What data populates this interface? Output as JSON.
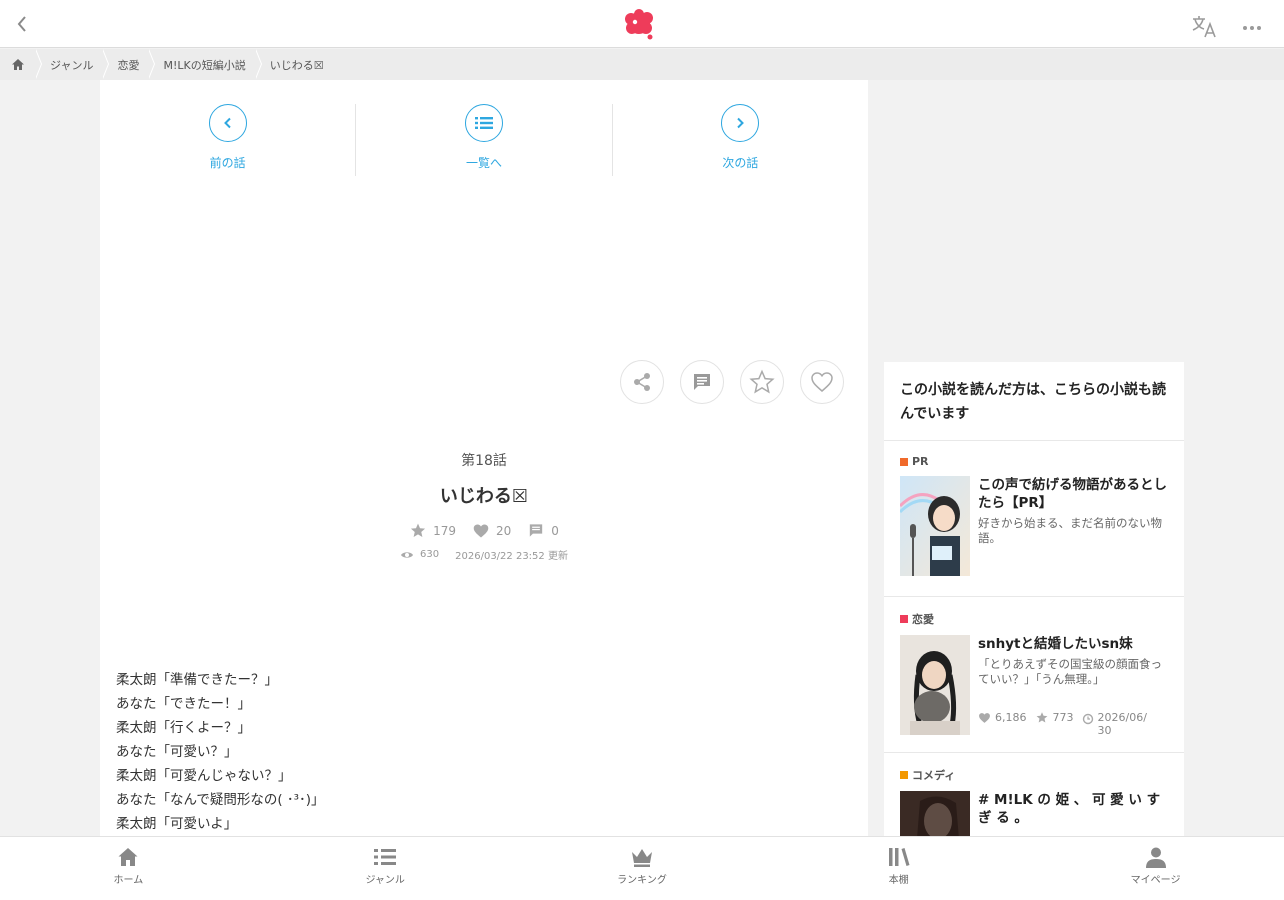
{
  "header": {
    "back_icon": "chevron-left-icon",
    "logo_color": "#ee3c5a",
    "translate_icon": "translate-icon",
    "more_icon": "more-horizontal-icon"
  },
  "breadcrumb": {
    "items": [
      {
        "label": "ジャンル"
      },
      {
        "label": "恋愛"
      },
      {
        "label": "M!LKの短編小説"
      },
      {
        "label": "いじわる☒"
      }
    ]
  },
  "episode_nav": {
    "prev_label": "前の話",
    "list_label": "一覧へ",
    "next_label": "次の話",
    "accent": "#2ea7e0"
  },
  "episode": {
    "number": "第18話",
    "title": "いじわる☒",
    "stars": "179",
    "likes": "20",
    "comments": "0",
    "views": "630",
    "updated": "2026/03/22 23:52 更新"
  },
  "body_lines": [
    "柔太朗「準備できたー？」",
    "あなた「できたー！」",
    "柔太朗「行くよー？」",
    "あなた「可愛い？」",
    "柔太朗「可愛んじゃない？」",
    "あなた「なんで疑問形なの( ･³･)」",
    "柔太朗「可愛いよ」"
  ],
  "sidebar": {
    "title": "この小説を読んだ方は、こちらの小説も読んでいます",
    "recs": [
      {
        "genre": "PR",
        "genre_color": "#f06a2b",
        "title": "この声で紡げる物語があるとしたら【PR】",
        "desc": "好きから始まる、まだ名前のない物語。"
      },
      {
        "genre": "恋愛",
        "genre_color": "#ee3c5a",
        "title": "snhytと結婚したいsn妹",
        "desc": "「とりあえずその国宝級の顔面食っていい？」「うん無理。」",
        "likes": "6,186",
        "stars": "773",
        "updated": "2026/06/30"
      },
      {
        "genre": "コメディ",
        "genre_color": "#f39800",
        "title": "# M!LK の 姫 、 可 愛 い す ぎ る 。",
        "desc": ""
      }
    ]
  },
  "bottom_nav": {
    "tabs": [
      {
        "label": "ホーム",
        "icon": "home-icon"
      },
      {
        "label": "ジャンル",
        "icon": "list-icon"
      },
      {
        "label": "ランキング",
        "icon": "crown-icon"
      },
      {
        "label": "本棚",
        "icon": "bookshelf-icon"
      },
      {
        "label": "マイページ",
        "icon": "user-icon"
      }
    ]
  }
}
